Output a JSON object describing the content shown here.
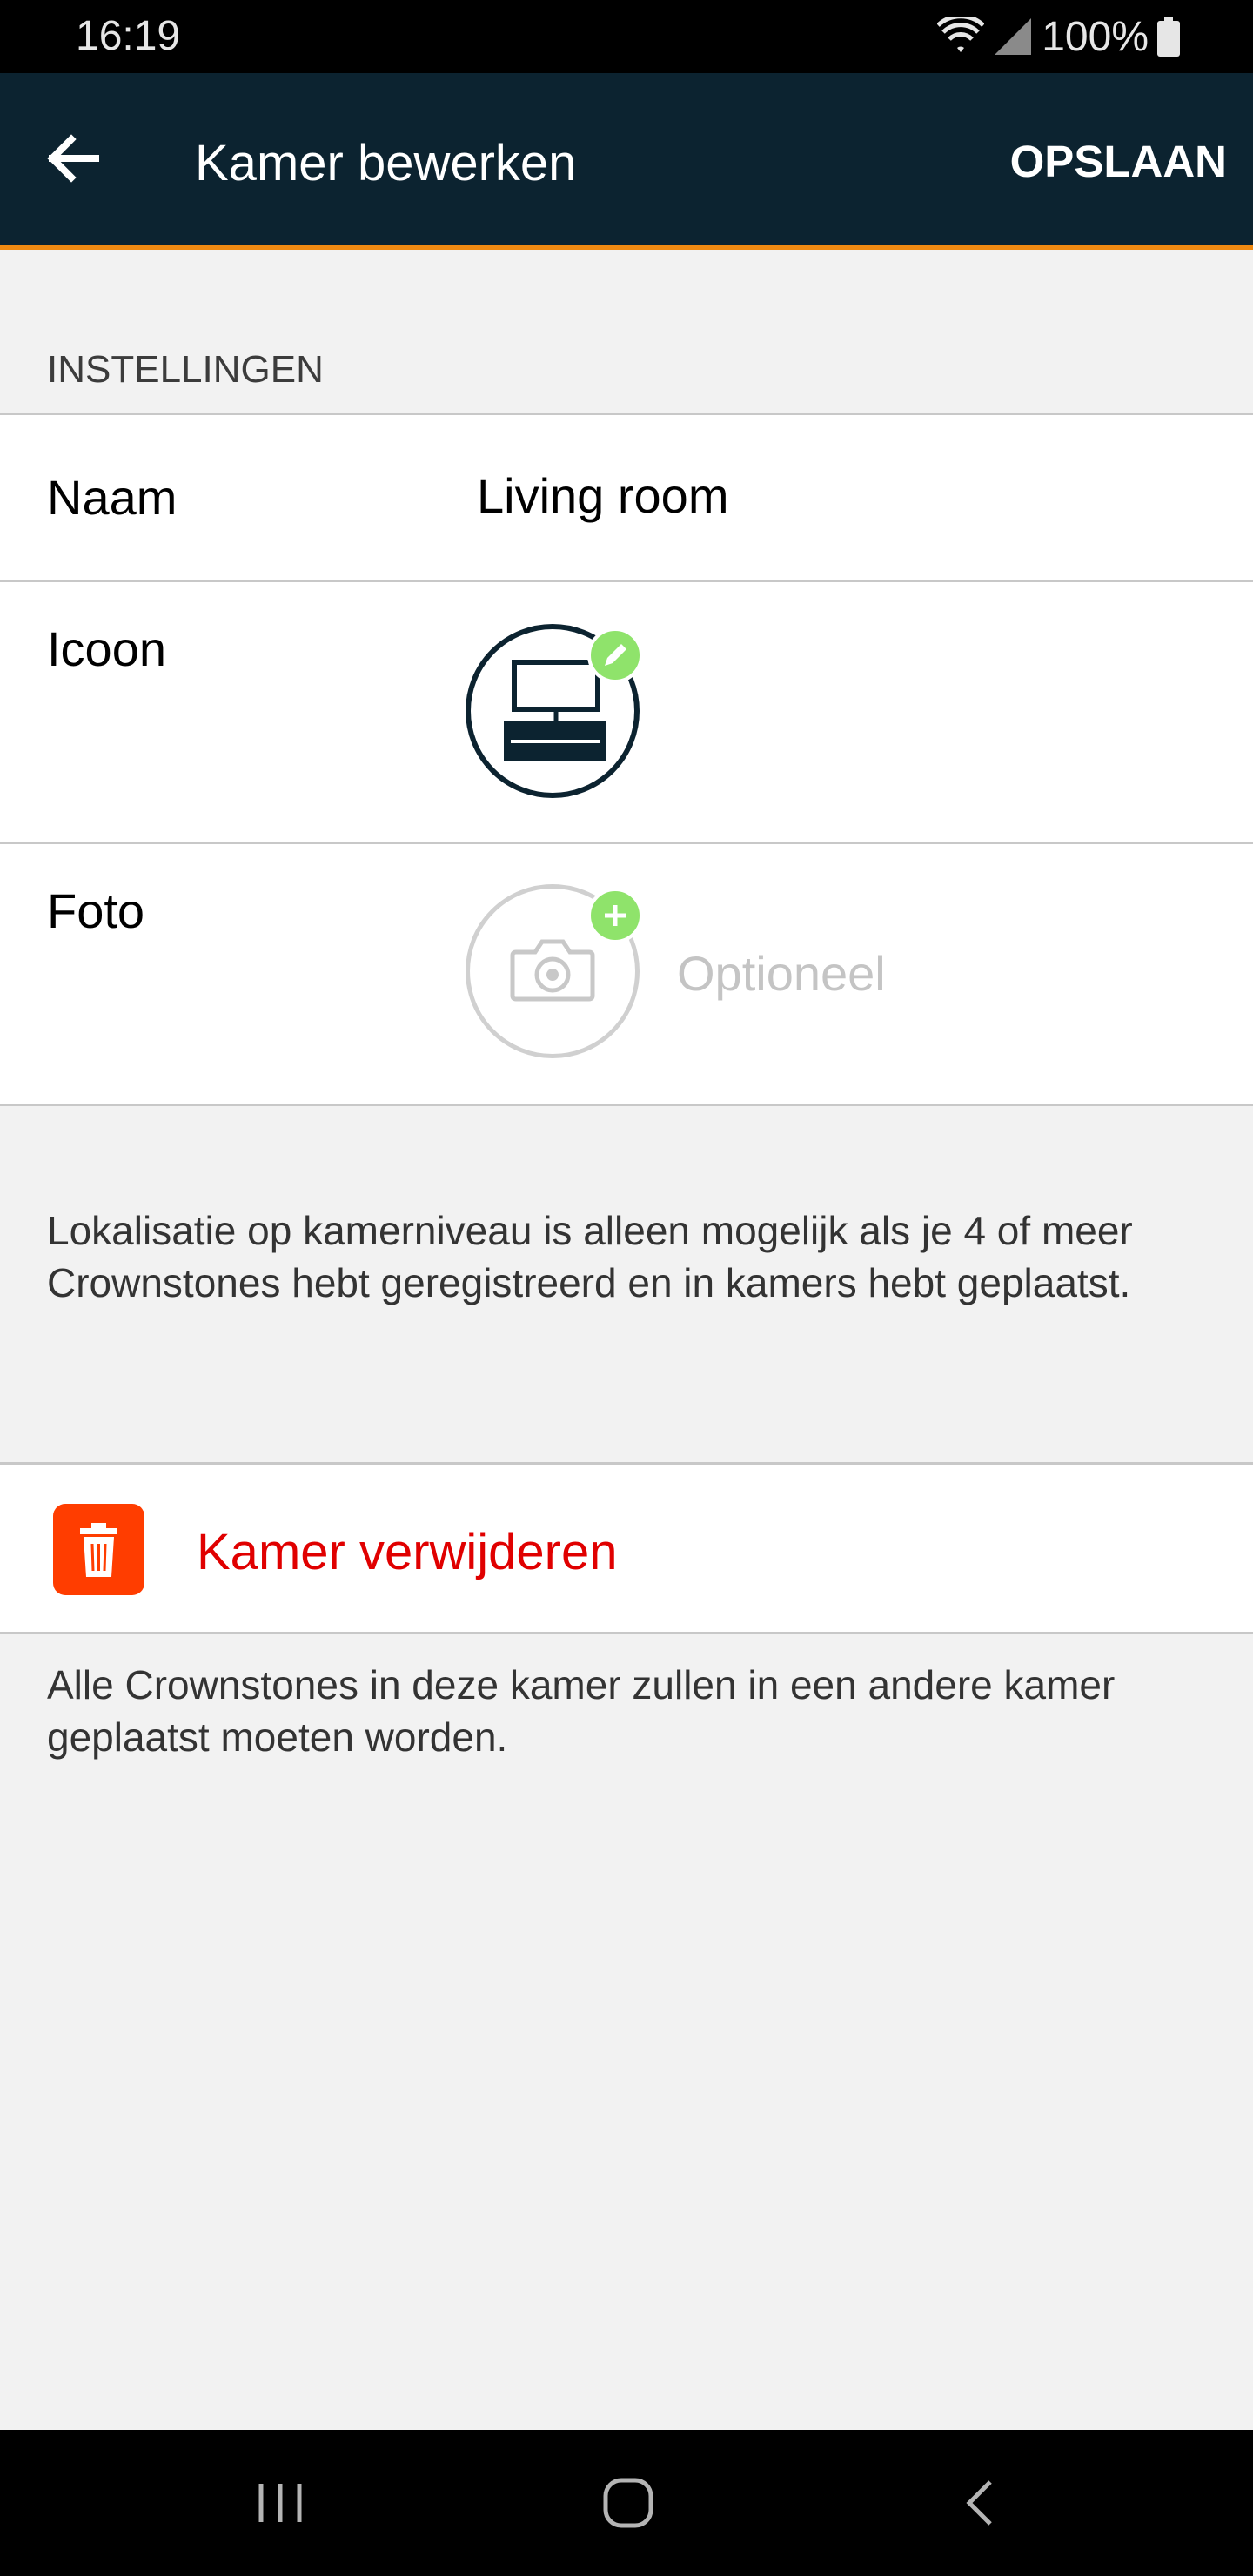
{
  "status_bar": {
    "time": "16:19",
    "battery": "100%"
  },
  "header": {
    "title": "Kamer bewerken",
    "save_label": "OPSLAAN",
    "background": "#0c2330",
    "accent": "#f08a12"
  },
  "settings": {
    "section_title": "INSTELLINGEN",
    "name_label": "Naam",
    "name_value": "Living room",
    "icon_label": "Icoon",
    "photo_label": "Foto",
    "photo_placeholder": "Optioneel",
    "badge_color": "#8fe36b"
  },
  "localization_note": "Lokalisatie op kamerniveau is alleen mogelijk als je 4 of meer Crownstones hebt geregistreerd en in kamers hebt geplaatst.",
  "delete": {
    "label": "Kamer verwijderen",
    "note": "Alle Crownstones in deze kamer zullen in een andere kamer geplaatst moeten worden.",
    "icon_color": "#ff3d00",
    "text_color": "#e00000"
  },
  "icons": {
    "back": "arrow-left-icon",
    "room": "tv-desk-icon",
    "edit": "pencil-icon",
    "photo": "camera-icon",
    "add": "plus-icon",
    "delete": "trash-icon"
  }
}
